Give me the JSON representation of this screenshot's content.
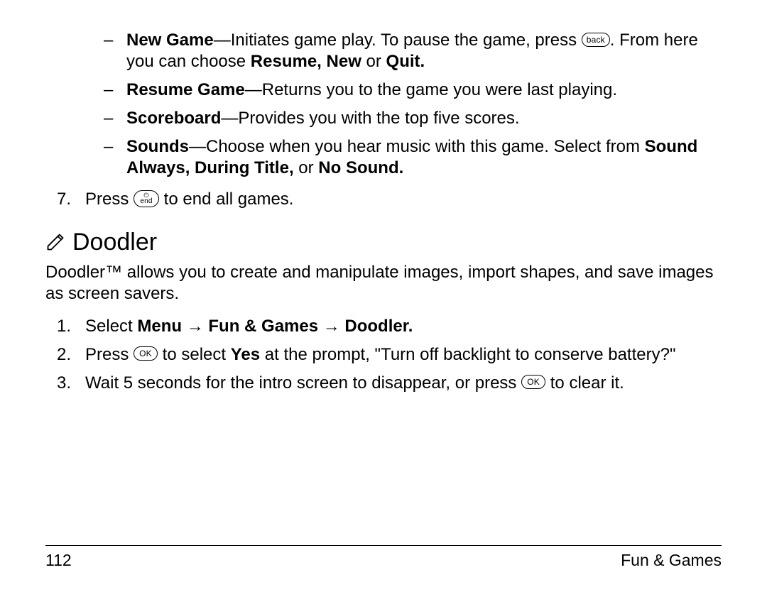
{
  "dashItems": [
    {
      "leadBold": "New Game",
      "text1": "—Initiates game play. To pause the game, press ",
      "key1": "back",
      "text2": ". From here you can choose ",
      "trailBold": "Resume, New ",
      "text3": "or ",
      "trailBold2": "Quit.",
      "hasKey": true
    },
    {
      "leadBold": "Resume Game",
      "text1": "—Returns you to the game you were last playing.",
      "hasKey": false
    },
    {
      "leadBold": "Scoreboard",
      "text1": "—Provides you with the top five scores.",
      "hasKey": false
    },
    {
      "leadBold": "Sounds",
      "text1": "—Choose when you hear music with this game. Select from ",
      "trailBold": "Sound Always, During Title, ",
      "text3": "or ",
      "trailBold2": "No Sound.",
      "hasKey": false
    }
  ],
  "endGames": {
    "num": "7.",
    "pre": "Press ",
    "keyTop": "⏻",
    "keyBottom": "end",
    "post": " to end all games."
  },
  "heading": "Doodler",
  "intro": "Doodler™ allows you to create and manipulate images, import shapes, and save images as screen savers.",
  "steps": [
    {
      "num": "1.",
      "plain1": "Select ",
      "bold": "Menu → Fun & Games → Doodler."
    },
    {
      "num": "2.",
      "plain1": "Press ",
      "key": "OK",
      "plain2": " to select ",
      "bold": "Yes",
      "plain3": " at the prompt, \"Turn off backlight to conserve battery?\""
    },
    {
      "num": "3.",
      "plain1": "Wait 5 seconds for the intro screen to disappear, or press ",
      "key": "OK",
      "plain2": " to clear it."
    }
  ],
  "footer": {
    "pageNum": "112",
    "section": "Fun & Games"
  }
}
